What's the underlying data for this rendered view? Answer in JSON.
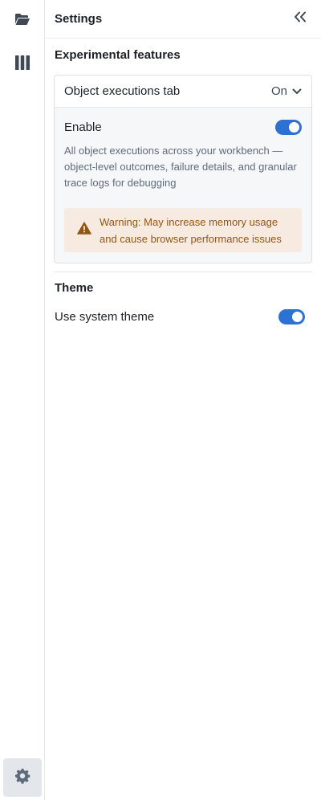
{
  "rail": {
    "items": [
      {
        "icon": "folder-open-icon"
      },
      {
        "icon": "columns-icon"
      }
    ],
    "bottom": {
      "icon": "gear-icon",
      "active": true
    }
  },
  "panel": {
    "title": "Settings",
    "collapse_icon": "double-chevron-left-icon"
  },
  "experimental": {
    "heading": "Experimental features",
    "feature": {
      "name": "Object executions tab",
      "value": "On",
      "enable_label": "Enable",
      "enabled": true,
      "description": "All object executions across your workbench — object-level outcomes, failure details, and granular trace logs for debugging",
      "warning": "Warning: May increase memory usage and cause browser performance issues"
    }
  },
  "theme": {
    "heading": "Theme",
    "system_label": "Use system theme",
    "system_enabled": true
  },
  "colors": {
    "accent": "#2d72d2",
    "warning_bg": "#f7ebe1",
    "warning_text": "#935610",
    "warning_icon": "#935610"
  }
}
